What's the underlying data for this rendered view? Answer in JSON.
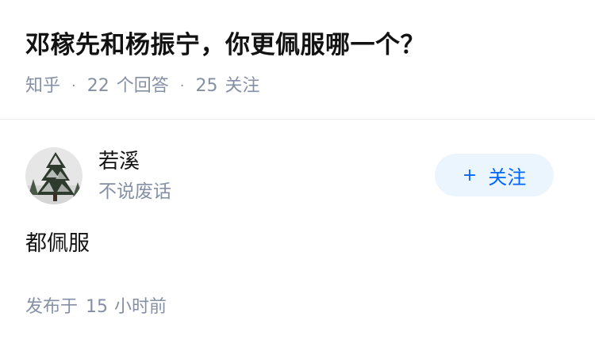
{
  "question": {
    "title": "邓稼先和杨振宁，你更佩服哪一个？",
    "source": "知乎",
    "answer_count": "22",
    "answer_label": "个回答",
    "follower_count": "25",
    "follower_label": "关注",
    "separator": "·"
  },
  "author": {
    "name": "若溪",
    "headline": "不说废话",
    "avatar_icon": "snowy-tree-avatar",
    "follow": {
      "icon": "plus-icon",
      "symbol": "+",
      "label": "关注"
    }
  },
  "answer": {
    "content": "都佩服"
  },
  "publish": {
    "prefix": "发布于",
    "number": "15",
    "suffix": "小时前"
  },
  "colors": {
    "title": "#121212",
    "meta": "#8590a6",
    "accent": "#0066ff",
    "button_bg": "#ebf5fd",
    "divider": "#ebebeb"
  }
}
